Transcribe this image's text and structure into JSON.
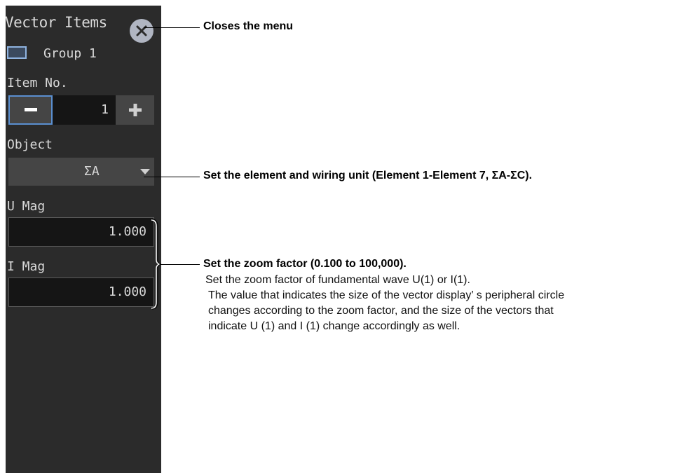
{
  "panel": {
    "title": "Vector Items",
    "group_label": "Group 1",
    "item_no_label": "Item No.",
    "item_no_value": "1",
    "object_label": "Object",
    "object_value": "ΣA",
    "u_mag_label": "U Mag",
    "u_mag_value": "1.000",
    "i_mag_label": "I Mag",
    "i_mag_value": "1.000"
  },
  "annotations": {
    "close": "Closes the menu",
    "object": "Set the element and wiring unit (Element 1-Element 7, ΣA-ΣC).",
    "zoom_title": "Set the zoom factor (0.100 to 100,000).",
    "zoom_line1": "Set the zoom factor of fundamental wave U(1) or I(1).",
    "zoom_line2": "The value that indicates the size of the vector display’ s peripheral circle",
    "zoom_line3": "changes according to the zoom factor, and the size of the vectors that",
    "zoom_line4": "indicate U (1) and I (1) change accordingly as well."
  },
  "icons": {
    "close": "close-icon",
    "group": "group-icon",
    "minus": "minus-icon",
    "plus": "plus-icon",
    "dropdown": "chevron-down-icon"
  },
  "colors": {
    "panel_bg": "#2b2b2b",
    "accent_border": "#5a8fd0",
    "close_button": "#b0b5c2"
  }
}
